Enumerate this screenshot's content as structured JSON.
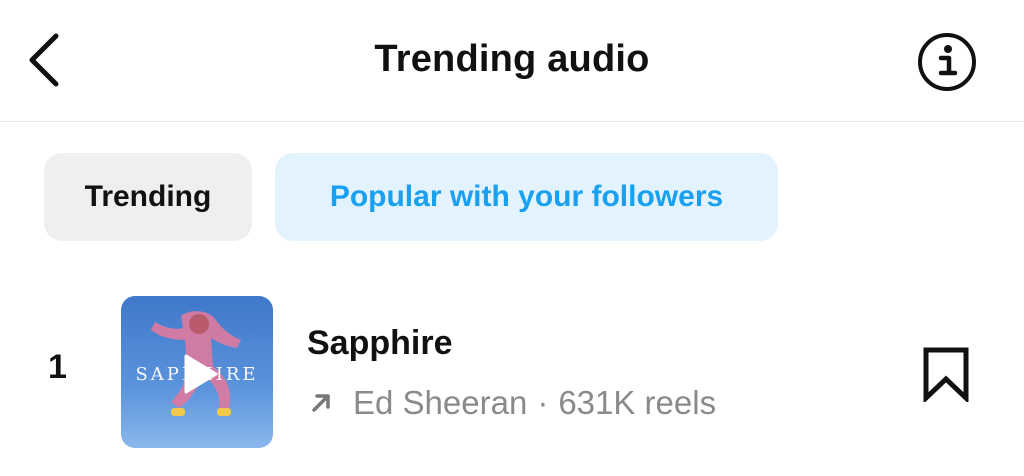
{
  "header": {
    "title": "Trending audio",
    "back_icon": "chevron-left-icon",
    "info_icon": "info-icon"
  },
  "tabs": [
    {
      "label": "Trending",
      "selected": false
    },
    {
      "label": "Popular with your followers",
      "selected": true
    }
  ],
  "tracks": [
    {
      "rank": "1",
      "title": "Sapphire",
      "artist": "Ed Sheeran",
      "separator": "·",
      "reels": "631K reels",
      "cover_text": "SAPPHIRE",
      "trend_icon": "arrow-up-right-icon",
      "play_icon": "play-icon",
      "save_icon": "bookmark-icon"
    }
  ],
  "colors": {
    "accent": "#1aa0f0",
    "accent_bg": "#e3f3fd",
    "tab_bg": "#efefef",
    "muted_text": "#8a8a8a"
  }
}
